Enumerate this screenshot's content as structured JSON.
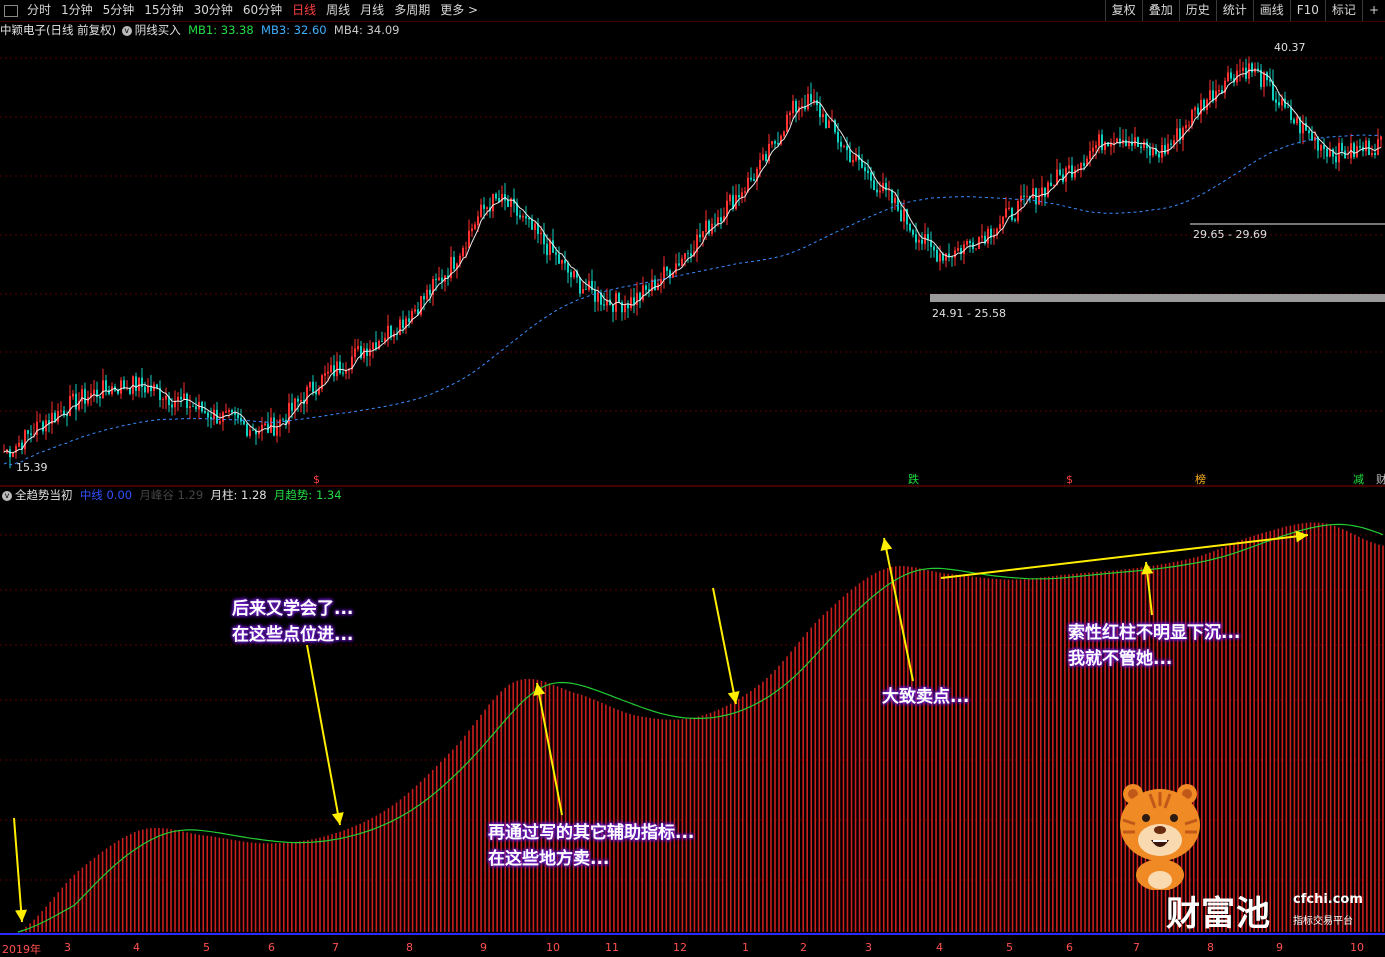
{
  "toolbar": {
    "periods": [
      "分时",
      "1分钟",
      "5分钟",
      "15分钟",
      "30分钟",
      "60分钟",
      "日线",
      "周线",
      "月线",
      "多周期",
      "更多 >"
    ],
    "active_period": "日线",
    "right_buttons": [
      "复权",
      "叠加",
      "历史",
      "统计",
      "画线",
      "F10",
      "标记",
      "+"
    ]
  },
  "upper_panel": {
    "stock_label": "中颖电子(日线 前复权)",
    "indicator_name": "阴线买入",
    "mb1_label": "MB1: 33.38",
    "mb3_label": "MB3: 32.60",
    "mb4_label": "MB4: 34.09",
    "price_high_label": "40.37",
    "price_low_label": "15.39",
    "range_label_1": "29.65 - 29.69",
    "range_label_2": "24.91 - 25.58",
    "markers": [
      "$",
      "跌",
      "$",
      "榜",
      "减",
      "财"
    ]
  },
  "lower_panel": {
    "indicator_name": "全趋势当初",
    "zhongxian_label": "中线",
    "zhongxian_value": "0.00",
    "yuefeng_label": "月峰谷",
    "yuefeng_value": "1.29",
    "yuezhu_label": "月柱: 1.28",
    "yuequshi_label": "月趋势: 1.34"
  },
  "x_axis": {
    "labels": [
      "2019年",
      "3",
      "4",
      "5",
      "6",
      "7",
      "8",
      "9",
      "10",
      "11",
      "12",
      "1",
      "2",
      "3",
      "4",
      "5",
      "6",
      "7",
      "8",
      "9",
      "10"
    ]
  },
  "annotations": [
    {
      "line1": "后来又学会了...",
      "line2": "在这些点位进..."
    },
    {
      "line1": "再通过写的其它辅助指标...",
      "line2": "在这些地方卖..."
    },
    {
      "line1": "大致卖点...",
      "line2": ""
    },
    {
      "line1": "索性红柱不明显下沉...",
      "line2": "我就不管她..."
    }
  ],
  "watermark": {
    "brand": "财富池",
    "site": "cfchi.com",
    "slogan": "指标交易平台"
  },
  "colors": {
    "bar_red": "#c81e1e",
    "trend_green": "#22cc33",
    "ma_white": "#e8e8e8",
    "dashed_blue": "#3a8cff",
    "arrow_yellow": "#ffee00",
    "callout_purple": "#6a1cc0",
    "grid_red": "#5a0000"
  },
  "chart_data": [
    {
      "type": "line",
      "title": "",
      "ylabel": "",
      "price_range": [
        15.39,
        40.37
      ],
      "series": [
        {
          "values": [
            16,
            18,
            19.5,
            20,
            19,
            18,
            17.5,
            20,
            22,
            24,
            27,
            31,
            29,
            26,
            25,
            27,
            30,
            33,
            37,
            34,
            31,
            28,
            29,
            31,
            33,
            35,
            34,
            37,
            39,
            36,
            34,
            34.5
          ]
        }
      ]
    },
    {
      "type": "bar",
      "title": "",
      "ylabel": "",
      "series": [
        {
          "values": [
            0,
            0.55,
            0.9,
            0.85,
            0.78,
            0.85,
            1.1,
            1.6,
            2.2,
            2.1,
            1.9,
            1.9,
            2.2,
            2.8,
            3.2,
            3.15,
            3.1,
            3.15,
            3.2,
            3.3,
            3.5,
            3.6,
            3.4
          ]
        }
      ]
    }
  ]
}
